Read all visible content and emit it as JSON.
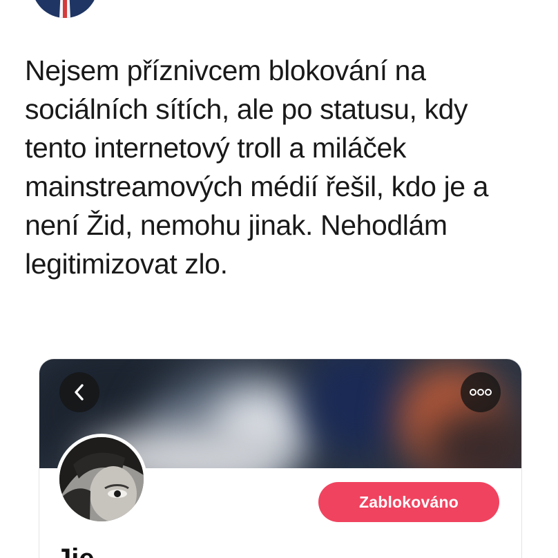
{
  "tweet": {
    "lines": [
      "Nejsem příznivcem blokování na",
      "sociálních sítích, ale po statusu, kdy",
      "tento internetový troll a miláček",
      "mainstreamových médií řešil, kdo je a",
      "není Žid, nemohu jinak. Nehodlám",
      "legitimizovat zlo."
    ]
  },
  "embedded_profile": {
    "back_icon": "chevron-left-icon",
    "more_icon": "ellipsis-icon",
    "blocked_label": "Zablokováno",
    "display_name": "Jie"
  },
  "colors": {
    "text": "#191919",
    "blocked_button": "#f0435f",
    "round_button_bg": "#141414",
    "author_avatar_bg": "#1f3563"
  }
}
